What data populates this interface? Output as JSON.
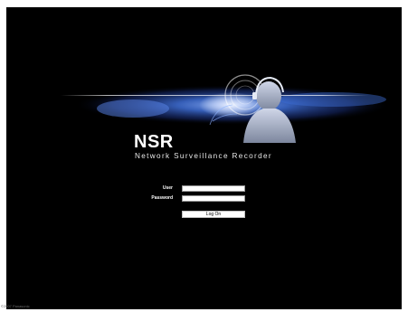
{
  "app": {
    "logo_title": "NSR",
    "logo_subtitle": "Network Surveillance Recorder"
  },
  "login_form": {
    "user_label": "User",
    "user_value": "",
    "password_label": "Password",
    "password_value": "",
    "login_button_label": "Log On"
  },
  "footer": {
    "copyright": "©2007 Panasonic"
  },
  "colors": {
    "background": "#000000",
    "banner_blue": "#3f6fd8",
    "text": "#ffffff"
  }
}
